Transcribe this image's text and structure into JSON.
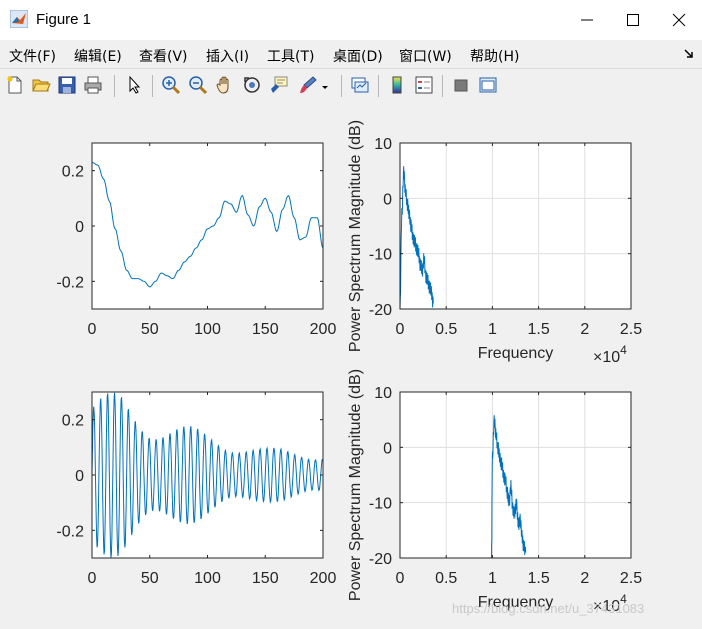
{
  "window": {
    "title": "Figure 1",
    "controls": [
      "minimize",
      "maximize",
      "close"
    ]
  },
  "menubar": {
    "items": [
      {
        "label": "文件(F)"
      },
      {
        "label": "编辑(E)"
      },
      {
        "label": "查看(V)"
      },
      {
        "label": "插入(I)"
      },
      {
        "label": "工具(T)"
      },
      {
        "label": "桌面(D)"
      },
      {
        "label": "窗口(W)"
      },
      {
        "label": "帮助(H)"
      }
    ],
    "overflow_icon": "dock-arrow-icon"
  },
  "toolbar": {
    "buttons": [
      "new-figure-icon",
      "open-file-icon",
      "save-icon",
      "print-icon",
      "select-arrow-icon",
      "zoom-in-icon",
      "zoom-out-icon",
      "pan-hand-icon",
      "rotate-3d-icon",
      "data-cursor-icon",
      "brush-icon",
      "link-plot-icon",
      "colorbar-icon",
      "legend-icon",
      "hide-plot-tools-icon",
      "show-plot-tools-icon"
    ]
  },
  "colors": {
    "line": "#0072bd",
    "axes_bg": "#ffffff",
    "figure_bg": "#f0f0f0",
    "grid": "#dfdfdf"
  },
  "chart_data": [
    {
      "type": "line",
      "title": "",
      "xlabel": "",
      "ylabel": "",
      "xlim": [
        0,
        200
      ],
      "ylim": [
        -0.3,
        0.3
      ],
      "xticks": [
        "0",
        "50",
        "100",
        "150",
        "200"
      ],
      "yticks": [
        "-0.2",
        "0",
        "0.2"
      ],
      "grid": false,
      "series": [
        {
          "x": [
            0,
            5,
            10,
            15,
            20,
            25,
            30,
            35,
            40,
            45,
            50,
            55,
            60,
            65,
            70,
            75,
            80,
            85,
            90,
            95,
            100,
            105,
            110,
            115,
            120,
            125,
            130,
            135,
            140,
            145,
            150,
            155,
            160,
            165,
            170,
            175,
            180,
            185,
            190,
            195,
            200
          ],
          "values": [
            0.23,
            0.22,
            0.17,
            0.09,
            -0.01,
            -0.09,
            -0.16,
            -0.19,
            -0.19,
            -0.2,
            -0.22,
            -0.2,
            -0.17,
            -0.18,
            -0.19,
            -0.16,
            -0.13,
            -0.11,
            -0.08,
            -0.05,
            -0.01,
            0.0,
            0.03,
            0.09,
            0.08,
            0.05,
            0.11,
            0.04,
            0.0,
            0.07,
            0.1,
            0.05,
            -0.02,
            0.06,
            0.11,
            0.03,
            -0.05,
            -0.04,
            0.03,
            0.03,
            -0.08
          ]
        }
      ]
    },
    {
      "type": "line",
      "title": "",
      "xlabel": "Frequency",
      "ylabel": "Power Spectrum Magnitude (dB)",
      "x_multiplier": "×10^4",
      "xlim": [
        0,
        2.5
      ],
      "ylim": [
        -20,
        10
      ],
      "xticks": [
        "0",
        "0.5",
        "1",
        "1.5",
        "2",
        "2.5"
      ],
      "yticks": [
        "-20",
        "-10",
        "0",
        "10"
      ],
      "grid": true,
      "series": [
        {
          "x": [
            0,
            0.02,
            0.04,
            0.06,
            0.08,
            0.1,
            0.12,
            0.14,
            0.16,
            0.18,
            0.2,
            0.22,
            0.24,
            0.26,
            0.28,
            0.3,
            0.32,
            0.34,
            0.36
          ],
          "values": [
            -20,
            -3,
            5,
            1,
            -1,
            -3,
            -5,
            -7,
            -8,
            -9,
            -10,
            -12,
            -13,
            -11,
            -14,
            -15,
            -16,
            -17,
            -19
          ]
        }
      ]
    },
    {
      "type": "line",
      "title": "",
      "xlabel": "",
      "ylabel": "",
      "xlim": [
        0,
        200
      ],
      "ylim": [
        -0.3,
        0.3
      ],
      "xticks": [
        "0",
        "50",
        "100",
        "150",
        "200"
      ],
      "yticks": [
        "-0.2",
        "0",
        "0.2"
      ],
      "grid": false,
      "series": [
        {
          "period": 6.0,
          "envelope_x": [
            0,
            25,
            50,
            100,
            150,
            200
          ],
          "envelope": [
            0.3,
            0.3,
            0.22,
            0.16,
            0.1,
            0.09
          ]
        }
      ]
    },
    {
      "type": "line",
      "title": "",
      "xlabel": "Frequency",
      "ylabel": "Power Spectrum Magnitude (dB)",
      "x_multiplier": "×10^4",
      "xlim": [
        0,
        2.5
      ],
      "ylim": [
        -20,
        10
      ],
      "xticks": [
        "0",
        "0.5",
        "1",
        "1.5",
        "2",
        "2.5"
      ],
      "yticks": [
        "-20",
        "-10",
        "0",
        "10"
      ],
      "grid": true,
      "series": [
        {
          "x": [
            0.99,
            1.0,
            1.02,
            1.04,
            1.06,
            1.08,
            1.1,
            1.12,
            1.14,
            1.16,
            1.18,
            1.2,
            1.22,
            1.24,
            1.26,
            1.28,
            1.3,
            1.32,
            1.34,
            1.36
          ],
          "values": [
            -20,
            -2,
            5,
            2,
            0,
            -2,
            -3,
            -5,
            -6,
            -8,
            -10,
            -7,
            -11,
            -12,
            -10,
            -14,
            -13,
            -16,
            -18,
            -19
          ]
        }
      ]
    }
  ],
  "watermark": "https://blog.csdn.net/u_37431083"
}
